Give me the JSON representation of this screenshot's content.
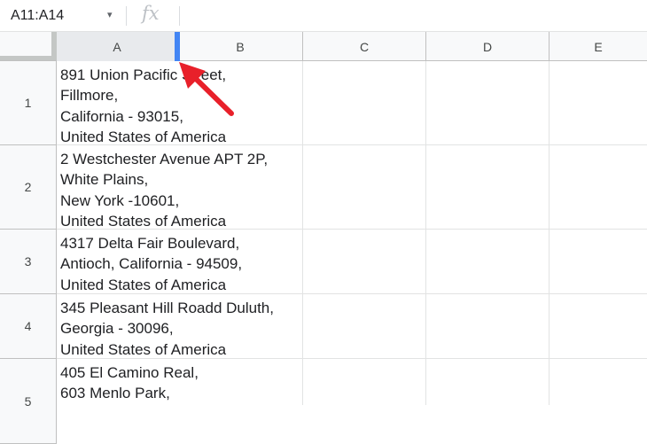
{
  "formula_bar": {
    "name_box": "A11:A14",
    "caret": "▾",
    "fx_label": "fx"
  },
  "columns": [
    "A",
    "B",
    "C",
    "D",
    "E"
  ],
  "rows": [
    {
      "number": "1",
      "A": [
        "891 Union Pacific Street,",
        "Fillmore,",
        "California - 93015,",
        "United States of America"
      ]
    },
    {
      "number": "2",
      "A": [
        "2 Westchester Avenue APT 2P,",
        "White Plains,",
        "New York -10601,",
        "United States of America"
      ]
    },
    {
      "number": "3",
      "A": [
        "4317 Delta Fair Boulevard,",
        "Antioch, California - 94509,",
        "United States of America"
      ]
    },
    {
      "number": "4",
      "A": [
        "345 Pleasant Hill Roadd Duluth,",
        "Georgia - 30096,",
        "United States of America"
      ]
    },
    {
      "number": "5",
      "A": [
        "405 El Camino Real,",
        "603 Menlo Park,"
      ]
    }
  ],
  "colors": {
    "resize_handle": "#4285f4",
    "arrow": "#e8202a",
    "selected_header": "#e8eaed"
  },
  "annotation": {
    "icon": "red-arrow-icon"
  }
}
